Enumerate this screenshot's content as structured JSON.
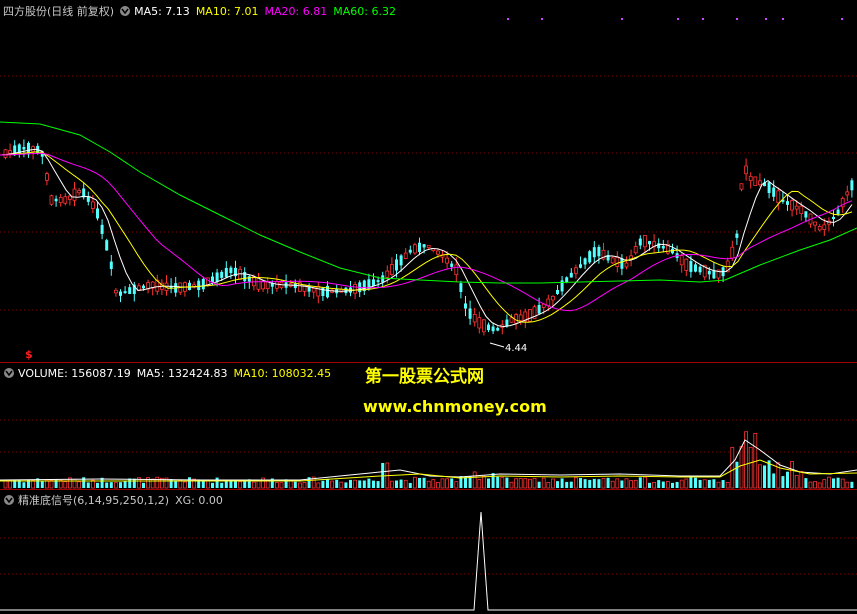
{
  "main_pane": {
    "title": "四方股份(日线 前复权)",
    "ma5": "MA5: 7.13",
    "ma10": "MA10: 7.01",
    "ma20": "MA20: 6.81",
    "ma60": "MA60: 6.32",
    "low_label": "4.44",
    "signal_marker": "$"
  },
  "volume_pane": {
    "title": "VOLUME: 156087.19",
    "ma5": "MA5: 132424.83",
    "ma10": "MA10: 108032.45"
  },
  "indicator_pane": {
    "title": "精准底信号(6,14,95,250,1,2)",
    "xg": "XG: 0.00"
  },
  "watermark": {
    "line1": "第一股票公式网",
    "line2": "www.chnmoney.com"
  },
  "colors": {
    "background": "#000000",
    "up": "#ff3232",
    "down": "#54ffff",
    "ma5": "#ffffff",
    "ma10": "#ffff00",
    "ma20": "#ff00ff",
    "ma60": "#00ff00",
    "grid": "#800000",
    "watermark": "#ffff00"
  },
  "icons": {
    "pane_toggle": "chevron-down-icon",
    "low_arrow": "left-arrow-icon"
  }
}
